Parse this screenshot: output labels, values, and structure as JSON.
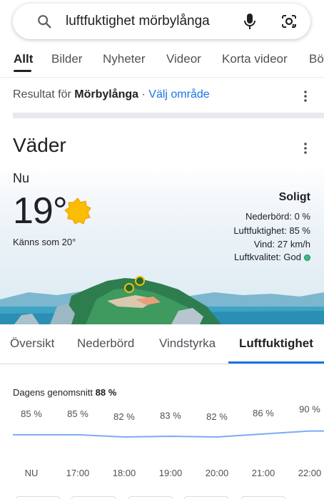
{
  "search": {
    "query": "luftfuktighet mörbylånga"
  },
  "tabs": [
    {
      "label": "Allt"
    },
    {
      "label": "Bilder"
    },
    {
      "label": "Nyheter"
    },
    {
      "label": "Videor"
    },
    {
      "label": "Korta videor"
    },
    {
      "label": "Bö"
    }
  ],
  "result": {
    "prefix": "Resultat för ",
    "place": "Mörbylånga",
    "separator": " · ",
    "link": "Välj område"
  },
  "weather": {
    "title": "Väder",
    "now_label": "Nu",
    "temperature": "19°",
    "feels_like": "Känns som 20°",
    "condition": "Soligt",
    "precipitation": "Nederbörd: 0 %",
    "humidity": "Luftfuktighet: 85 %",
    "wind": "Vind: 27 km/h",
    "air_quality": "Luftkvalitet: God",
    "tabs": [
      {
        "label": "Översikt"
      },
      {
        "label": "Nederbörd"
      },
      {
        "label": "Vindstyrka"
      },
      {
        "label": "Luftfuktighet"
      }
    ]
  },
  "humidity_chart": {
    "average_label": "Dagens genomsnitt ",
    "average_value": "88 %"
  },
  "chart_data": {
    "type": "line",
    "categories": [
      "NU",
      "17:00",
      "18:00",
      "19:00",
      "20:00",
      "21:00",
      "22:00"
    ],
    "values": [
      85,
      85,
      82,
      83,
      82,
      86,
      90
    ],
    "value_labels": [
      "85 %",
      "85 %",
      "82 %",
      "83 %",
      "82 %",
      "86 %",
      "90 %"
    ],
    "series_color": "#7baaf7"
  },
  "colors": {
    "accent": "#1a73e8",
    "sun": "#fbbc04",
    "air_quality_good": "#3cba8a"
  },
  "icons": [
    "search-icon",
    "microphone-icon",
    "lens-camera-icon",
    "more-vert-icon",
    "sun-icon"
  ]
}
